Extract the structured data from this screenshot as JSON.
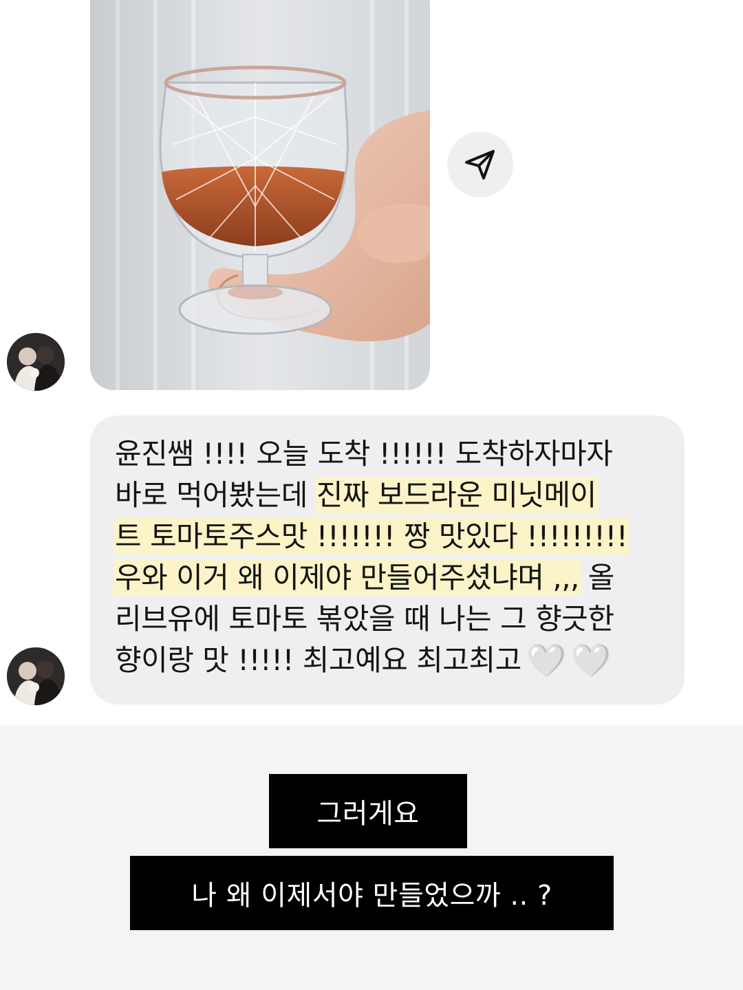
{
  "chat": {
    "photo": {
      "description_icon": "glass-photo"
    },
    "share_icon": "send-icon",
    "message_lines": [
      [
        {
          "t": "윤진쌤 !!!! 오늘 도착 !!!!!! 도착하자마자",
          "hl": false
        }
      ],
      [
        {
          "t": "바로 먹어봤는데 ",
          "hl": false
        },
        {
          "t": "진짜 보드라운 미닛메이",
          "hl": true
        }
      ],
      [
        {
          "t": "트 토마토주스맛 !!!!!!! 짱 맛있다 !!!!!!!!!",
          "hl": true
        }
      ],
      [
        {
          "t": "우와 이거 왜 이제야 만들어주셨냐며 ,,,",
          "hl": true
        },
        {
          "t": " 올",
          "hl": false
        }
      ],
      [
        {
          "t": "리브유에 토마토 볶았을 때 나는 그 향긋한",
          "hl": false
        }
      ],
      [
        {
          "t": "향이랑 맛 !!!!! 최고예요 최고최고",
          "hl": false
        }
      ]
    ],
    "hearts": [
      "🤍",
      "🤍"
    ],
    "colors": {
      "bubble": "#efeff1",
      "highlight": "#fbf4c8",
      "text": "#141414"
    }
  },
  "captions": {
    "line1": "그러게요",
    "line2": "나 왜 이제서야 만들었으까 .. ?",
    "colors": {
      "box": "#000000",
      "text": "#ffffff",
      "background": "#f4f4f4"
    }
  }
}
